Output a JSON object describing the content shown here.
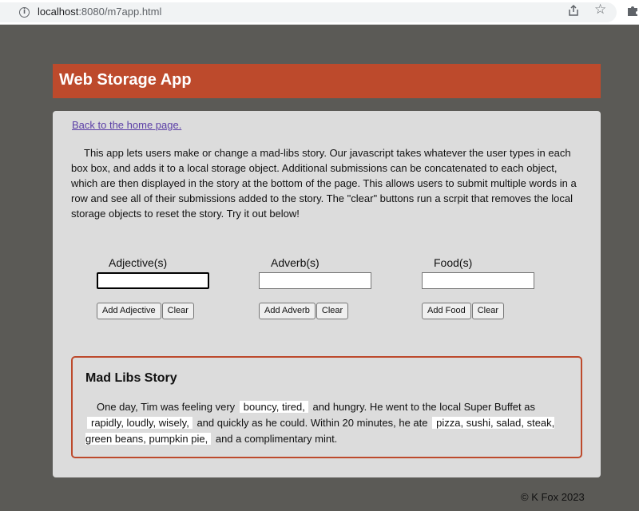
{
  "browser": {
    "url_host": "localhost",
    "url_path": ":8080/m7app.html"
  },
  "header": {
    "title": "Web Storage App"
  },
  "main": {
    "home_link": "Back to the home page.",
    "intro": "This app lets users make or change a mad-libs story. Our javascript takes whatever the user types in each box box, and adds it to a local storage object. Additional submissions can be concatenated to each object, which are then displayed in the story at the bottom of the page. This allows users to submit multiple words in a row and see all of their submissions added to the story. The \"clear\" buttons run a scrpit that removes the local storage objects to reset the story. Try it out below!",
    "fields": [
      {
        "label": "Adjective(s)",
        "value": "",
        "add_label": "Add Adjective",
        "clear_label": "Clear"
      },
      {
        "label": "Adverb(s)",
        "value": "",
        "add_label": "Add Adverb",
        "clear_label": "Clear"
      },
      {
        "label": "Food(s)",
        "value": "",
        "add_label": "Add Food",
        "clear_label": "Clear"
      }
    ]
  },
  "story": {
    "title": "Mad Libs Story",
    "part1": "One day, Tim was feeling very",
    "adjectives": "bouncy, tired,",
    "part2": "and hungry. He went to the local Super Buffet as",
    "adverbs": "rapidly, loudly, wisely,",
    "part3": "and quickly as he could. Within 20 minutes, he ate",
    "foods": "pizza, sushi, salad, steak, green beans, pumpkin pie,",
    "part4": "and a complimentary mint."
  },
  "footer": {
    "text": "© K Fox 2023"
  }
}
